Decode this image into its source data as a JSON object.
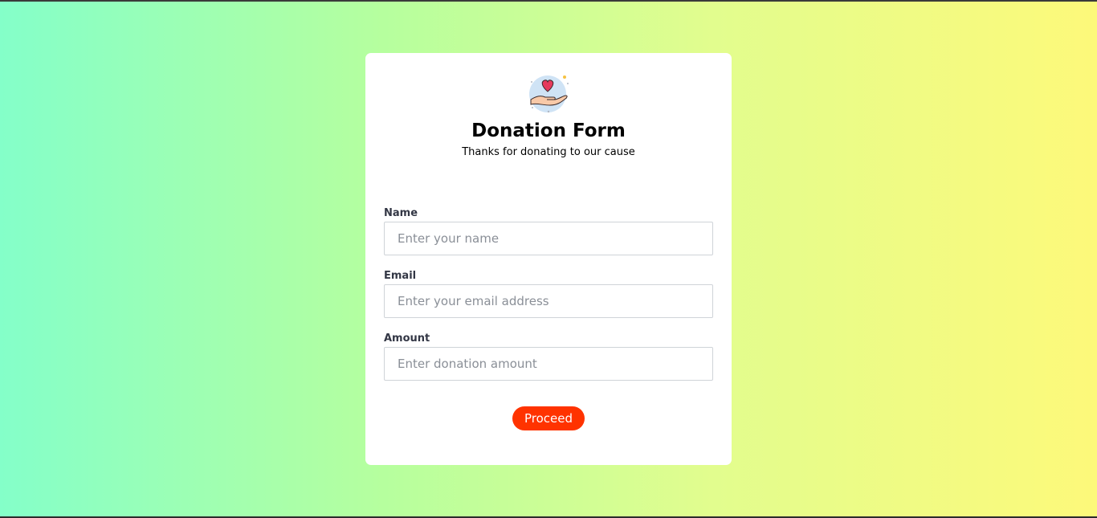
{
  "form": {
    "title": "Donation Form",
    "subtitle": "Thanks for donating to our cause",
    "logo_icon": "heart-in-hand-icon",
    "fields": [
      {
        "label": "Name",
        "placeholder": "Enter your name",
        "value": ""
      },
      {
        "label": "Email",
        "placeholder": "Enter your email address",
        "value": ""
      },
      {
        "label": "Amount",
        "placeholder": "Enter donation amount",
        "value": ""
      }
    ],
    "submit_label": "Proceed"
  },
  "colors": {
    "background_gradient": [
      "#84ffc9",
      "#b6ff9e",
      "#e2fd8e",
      "#fdf97a"
    ],
    "card": "#ffffff",
    "accent_button": "#ff3300",
    "heart": "#e63a5c",
    "logo_circle": "#cfe3f5"
  }
}
